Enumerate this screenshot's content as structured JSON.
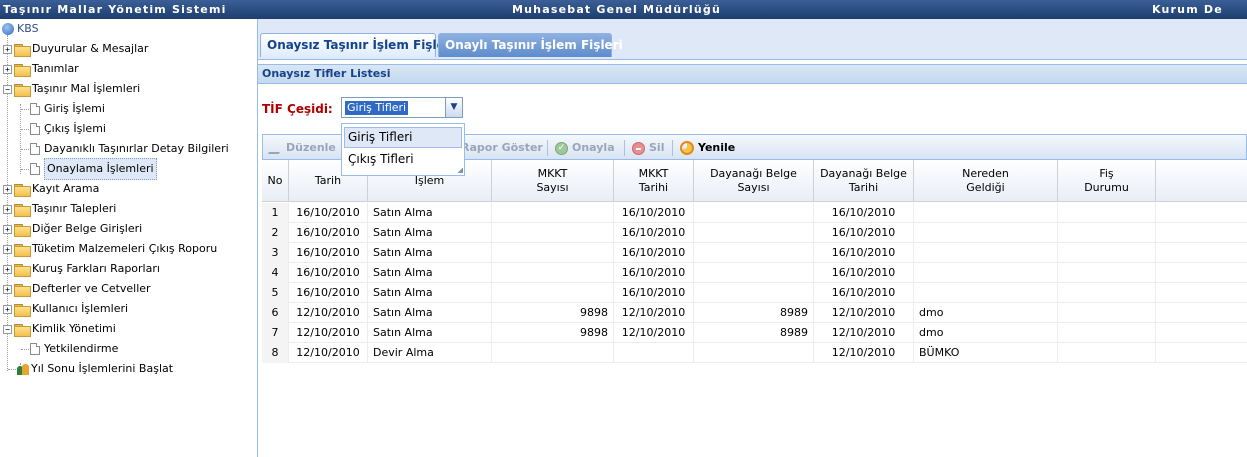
{
  "header": {
    "left_title": "Taşınır Mallar Yönetim Sistemi",
    "center_title": "Muhasebat Genel Müdürlüğü",
    "right_title": "Kurum De"
  },
  "sidebar": {
    "root": "KBS",
    "items": [
      {
        "label": "Duyurular & Mesajlar"
      },
      {
        "label": "Tanımlar"
      },
      {
        "label": "Taşınır Mal İşlemleri"
      },
      {
        "label": "Giriş İşlemi"
      },
      {
        "label": "Çıkış İşlemi"
      },
      {
        "label": "Dayanıklı Taşınırlar Detay Bilgileri"
      },
      {
        "label": "Onaylama İşlemleri"
      },
      {
        "label": "Kayıt Arama"
      },
      {
        "label": "Taşınır Talepleri"
      },
      {
        "label": "Diğer Belge Girişleri"
      },
      {
        "label": "Tüketim Malzemeleri Çıkış Roporu"
      },
      {
        "label": "Kuruş Farkları Raporları"
      },
      {
        "label": "Defterler ve Cetveller"
      },
      {
        "label": "Kullanıcı İşlemleri"
      },
      {
        "label": "Kimlik Yönetimi"
      },
      {
        "label": "Yetkilendirme"
      },
      {
        "label": "Yıl Sonu İşlemlerini Başlat"
      }
    ]
  },
  "tabs": [
    {
      "label": "Onaysız Taşınır İşlem Fişleri"
    },
    {
      "label": "Onaylı Taşınır İşlem Fişleri"
    }
  ],
  "panel_title": "Onaysız Tifler Listesi",
  "filter": {
    "label": "TİF Çeşidi:",
    "value": "Giriş Tifleri",
    "options": [
      "Giriş Tifleri",
      "Çıkış Tifleri"
    ]
  },
  "toolbar": {
    "edit": "Düzenle",
    "report": "Rapor Göster",
    "approve": "Onayla",
    "delete": "Sil",
    "refresh": "Yenile"
  },
  "table": {
    "headers": [
      "No",
      "Tarih",
      "İşlem",
      "MKKT\nSayısı",
      "MKKT\nTarihi",
      "Dayanağı Belge\nSayısı",
      "Dayanağı Belge\nTarihi",
      "Nereden\nGeldiği",
      "Fiş\nDurumu"
    ],
    "rows": [
      [
        "1",
        "16/10/2010",
        "Satın Alma",
        "",
        "16/10/2010",
        "",
        "16/10/2010",
        "",
        ""
      ],
      [
        "2",
        "16/10/2010",
        "Satın Alma",
        "",
        "16/10/2010",
        "",
        "16/10/2010",
        "",
        ""
      ],
      [
        "3",
        "16/10/2010",
        "Satın Alma",
        "",
        "16/10/2010",
        "",
        "16/10/2010",
        "",
        ""
      ],
      [
        "4",
        "16/10/2010",
        "Satın Alma",
        "",
        "16/10/2010",
        "",
        "16/10/2010",
        "",
        ""
      ],
      [
        "5",
        "16/10/2010",
        "Satın Alma",
        "",
        "16/10/2010",
        "",
        "16/10/2010",
        "",
        ""
      ],
      [
        "6",
        "12/10/2010",
        "Satın Alma",
        "9898",
        "12/10/2010",
        "8989",
        "12/10/2010",
        "dmo",
        ""
      ],
      [
        "7",
        "12/10/2010",
        "Satın Alma",
        "9898",
        "12/10/2010",
        "8989",
        "12/10/2010",
        "dmo",
        ""
      ],
      [
        "8",
        "12/10/2010",
        "Devir Alma",
        "",
        "",
        "",
        "12/10/2010",
        "BÜMKO",
        ""
      ]
    ]
  }
}
